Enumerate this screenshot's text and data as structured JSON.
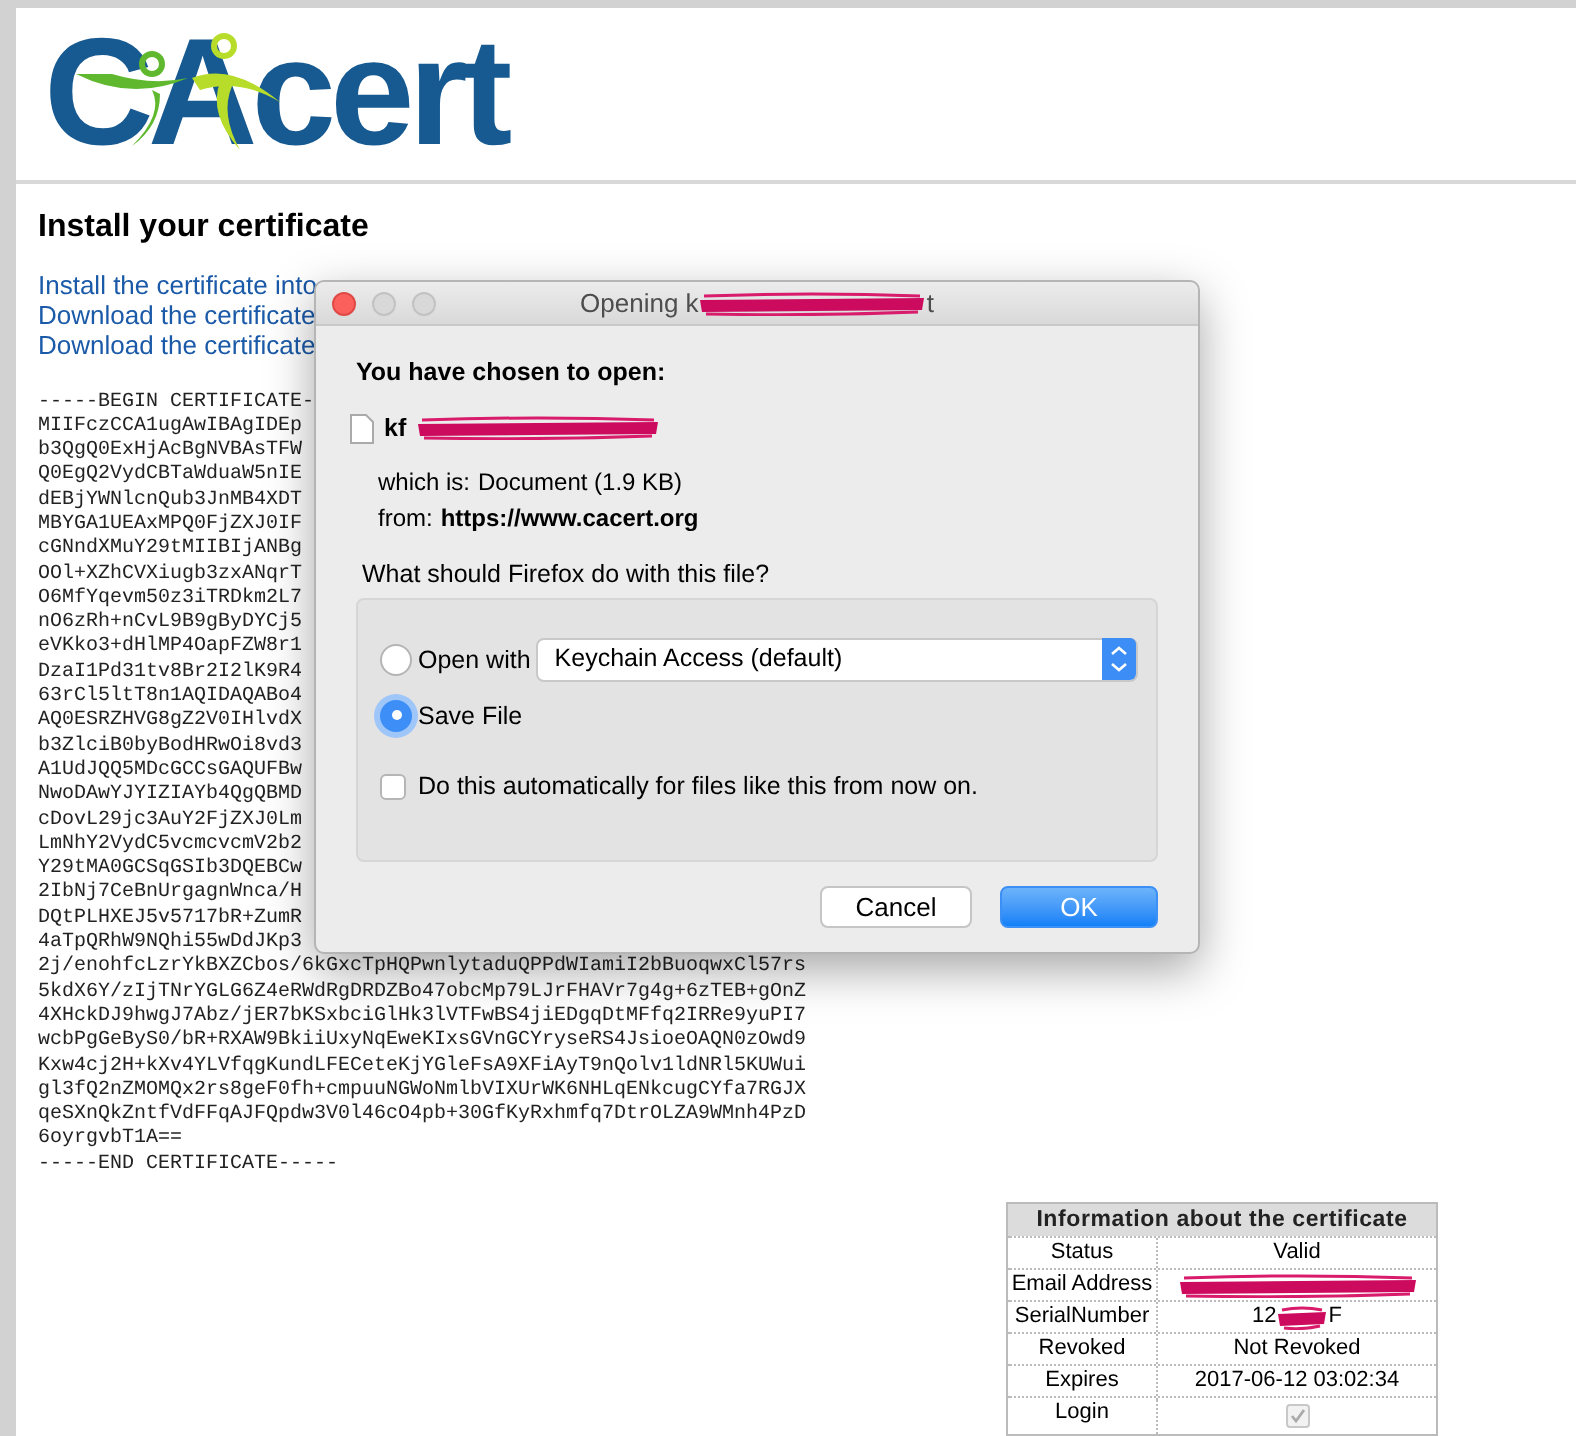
{
  "logo": {
    "text": "CAcert"
  },
  "page": {
    "heading": "Install your certificate",
    "links": [
      "Install the certificate into",
      "Download the certificate",
      "Download the certificate"
    ],
    "certificate_lines": [
      "-----BEGIN CERTIFICATE-",
      "MIIFczCCA1ugAwIBAgIDEp",
      "b3QgQ0ExHjAcBgNVBAsTFW",
      "Q0EgQ2VydCBTaWduaW5nIE",
      "dEBjYWNlcnQub3JnMB4XDT",
      "MBYGA1UEAxMPQ0FjZXJ0IF",
      "cGNndXMuY29tMIIBIjANBg",
      "OOl+XZhCVXiugb3zxANqrT",
      "O6MfYqevm50z3iTRDkm2L7",
      "nO6zRh+nCvL9B9gByDYCj5",
      "eVKko3+dHlMP4OapFZW8r1",
      "DzaI1Pd31tv8Br2I2lK9R4",
      "63rCl5ltT8n1AQIDAQABo4",
      "AQ0ESRZHVG8gZ2V0IHlvdX",
      "b3ZlciB0byBodHRwOi8vd3",
      "A1UdJQQ5MDcGCCsGAQUFBw",
      "NwoDAwYJYIZIAYb4QgQBMD",
      "cDovL29jc3AuY2FjZXJ0Lm",
      "LmNhY2VydC5vcmcvcmV2b2",
      "Y29tMA0GCSqGSIb3DQEBCw",
      "2IbNj7CeBnUrgagnWnca/H",
      "DQtPLHXEJ5v5717bR+ZumR",
      "4aTpQRhW9NQhi55wDdJKp3",
      "2j/enohfcLzrYkBXZCbos/6kGxcTpHQPwnlytaduQPPdWIamiI2bBuoqwxCl57rs",
      "5kdX6Y/zIjTNrYGLG6Z4eRWdRgDRDZBo47obcMp79LJrFHAVr7g4g+6zTEB+gOnZ",
      "4XHckDJ9hwgJ7Abz/jER7bKSxbciGlHk3lVTFwBS4jiEDgqDtMFfq2IRRe9yuPI7",
      "wcbPgGeByS0/bR+RXAW9BkiiUxyNqEweKIxsGVnGCYryseRS4JsioeOAQN0zOwd9",
      "Kxw4cj2H+kXv4YLVfqgKundLFECeteKjYGleFsA9XFiAyT9nQolv1ldNRl5KUWui",
      "gl3fQ2nZMOMQx2rs8geF0fh+cmpuuNGWoNmlbVIXUrWK6NHLqENkcugCYfa7RGJX",
      "qeSXnQkZntfVdFFqAJFQpdw3V0l46cO4pb+30GfKyRxhmfq7DtrOLZA9WMnh4PzD",
      "6oyrgvbT1A==",
      "-----END CERTIFICATE-----"
    ]
  },
  "dialog": {
    "title_start": "Opening k",
    "title_end": "t",
    "heading": "You have chosen to open:",
    "file_name_start": "kf",
    "which_is_label": "which is:",
    "which_is_value": "Document (1.9 KB)",
    "from_label": "from:",
    "from_value": "https://www.cacert.org",
    "question": "What should Firefox do with this file?",
    "options": [
      {
        "label": "Open with",
        "selected": false,
        "app": "Keychain Access (default)"
      },
      {
        "label": "Save File",
        "selected": true
      }
    ],
    "auto_checkbox": {
      "label": "Do this automatically for files like this from now on.",
      "checked": false
    },
    "buttons": [
      {
        "label": "Cancel",
        "default": false
      },
      {
        "label": "OK",
        "default": true
      }
    ]
  },
  "info_table": {
    "title": "Information about the certificate",
    "rows": [
      {
        "kind": "text",
        "label": "Status",
        "value": "Valid"
      },
      {
        "kind": "redacted",
        "label": "Email Address"
      },
      {
        "kind": "partial",
        "label": "SerialNumber",
        "value_start": "12",
        "value_end": "F"
      },
      {
        "kind": "text",
        "label": "Revoked",
        "value": "Not Revoked"
      },
      {
        "kind": "text",
        "label": "Expires",
        "value": "2017-06-12 03:02:34"
      },
      {
        "kind": "checkbox",
        "label": "Login",
        "checked": true,
        "disabled": true
      }
    ]
  }
}
